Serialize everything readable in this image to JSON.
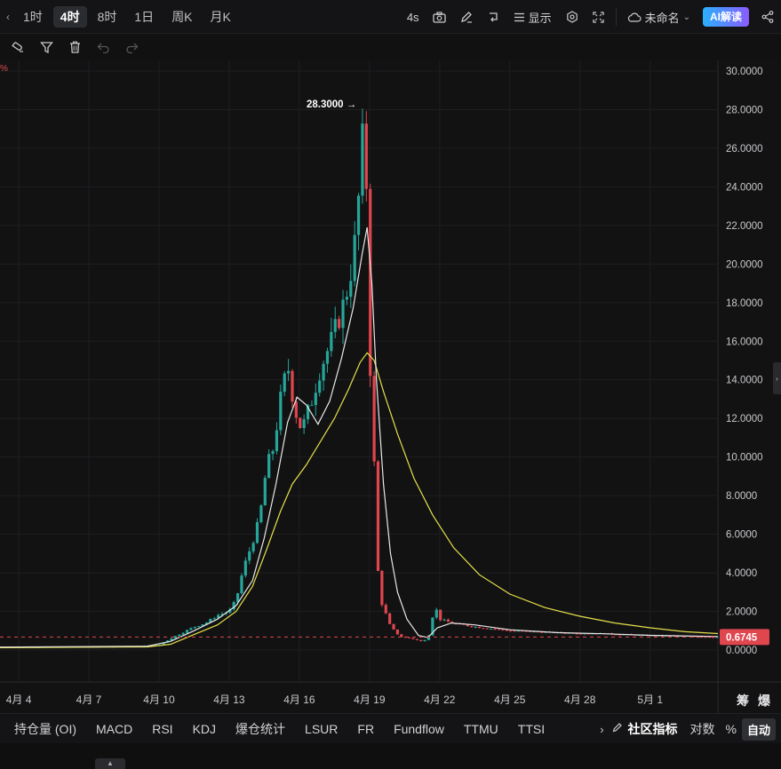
{
  "toolbar": {
    "timeframes": [
      "1时",
      "4时",
      "8时",
      "1日",
      "周K",
      "月K"
    ],
    "active_timeframe": "4时",
    "interval_label": "4s",
    "display_label": "显示",
    "layout_name": "未命名",
    "ai_label": "AI解读"
  },
  "draw_tools": [
    "magnet-icon",
    "filter-icon",
    "trash-icon",
    "undo-icon",
    "redo-icon"
  ],
  "corner_marker": "%",
  "chart_data": {
    "type": "candlestick",
    "title": "",
    "y_ticks": [
      "30.0000",
      "28.0000",
      "26.0000",
      "24.0000",
      "22.0000",
      "20.0000",
      "18.0000",
      "16.0000",
      "14.0000",
      "12.0000",
      "10.0000",
      "8.0000",
      "6.0000",
      "4.0000",
      "2.0000",
      "0.0000"
    ],
    "ylim": [
      0,
      30
    ],
    "x_ticks": [
      "4月 4",
      "4月 7",
      "4月 10",
      "4月 13",
      "4月 16",
      "4月 19",
      "4月 22",
      "4月 25",
      "4月 28",
      "5月 1"
    ],
    "x_tick_days": [
      4,
      7,
      10,
      13,
      16,
      19,
      22,
      25,
      28,
      31
    ],
    "x_range_days": [
      3.2,
      33.9
    ],
    "last_price": "0.6745",
    "last_price_value": 0.6745,
    "high_label": "28.3000",
    "high_value": 28.3,
    "high_day": 18.75,
    "up_color": "#26a69a",
    "down_color": "#e0464e",
    "ma_fast_color": "#e8e8e8",
    "ma_slow_color": "#e6e04a",
    "grid": true,
    "price_path": [
      [
        3.2,
        0.15
      ],
      [
        6,
        0.16
      ],
      [
        8,
        0.18
      ],
      [
        9,
        0.2
      ],
      [
        10,
        0.25
      ],
      [
        10.5,
        0.6
      ],
      [
        11,
        0.9
      ],
      [
        11.5,
        1.2
      ],
      [
        12,
        1.4
      ],
      [
        12.5,
        1.8
      ],
      [
        13,
        2.0
      ],
      [
        13.3,
        2.6
      ],
      [
        13.6,
        4.2
      ],
      [
        14,
        5.6
      ],
      [
        14.3,
        6.8
      ],
      [
        14.6,
        9.5
      ],
      [
        14.9,
        10.5
      ],
      [
        15.2,
        13.0
      ],
      [
        15.5,
        14.8
      ],
      [
        15.8,
        12.5
      ],
      [
        16.1,
        11.4
      ],
      [
        16.5,
        12.8
      ],
      [
        16.9,
        14.6
      ],
      [
        17.3,
        15.8
      ],
      [
        17.7,
        17.2
      ],
      [
        18.0,
        18.4
      ],
      [
        18.3,
        20.2
      ],
      [
        18.5,
        22.8
      ],
      [
        18.7,
        26.4
      ],
      [
        18.85,
        25.2
      ],
      [
        19.0,
        16.0
      ],
      [
        19.1,
        11.8
      ],
      [
        19.25,
        8.5
      ],
      [
        19.4,
        2.8
      ],
      [
        19.6,
        2.2
      ],
      [
        19.9,
        1.2
      ],
      [
        20.3,
        0.7
      ],
      [
        20.8,
        0.6
      ],
      [
        21.2,
        0.45
      ],
      [
        21.5,
        0.6
      ],
      [
        21.8,
        2.3
      ],
      [
        22.0,
        1.6
      ],
      [
        22.5,
        1.4
      ],
      [
        23.5,
        1.2
      ],
      [
        25,
        1.0
      ],
      [
        27,
        0.9
      ],
      [
        29,
        0.85
      ],
      [
        31,
        0.75
      ],
      [
        33.9,
        0.6745
      ]
    ],
    "ma_fast": [
      [
        3.2,
        0.15
      ],
      [
        9.5,
        0.2
      ],
      [
        10.5,
        0.45
      ],
      [
        11.5,
        1.0
      ],
      [
        12.5,
        1.6
      ],
      [
        13.3,
        2.3
      ],
      [
        14,
        3.6
      ],
      [
        14.5,
        5.8
      ],
      [
        15,
        8.6
      ],
      [
        15.5,
        11.8
      ],
      [
        15.9,
        13.1
      ],
      [
        16.3,
        12.7
      ],
      [
        16.8,
        11.7
      ],
      [
        17.3,
        12.9
      ],
      [
        17.8,
        15.1
      ],
      [
        18.3,
        17.7
      ],
      [
        18.7,
        20.6
      ],
      [
        18.9,
        21.9
      ],
      [
        19.1,
        19.0
      ],
      [
        19.3,
        14.0
      ],
      [
        19.6,
        8.6
      ],
      [
        19.9,
        5.0
      ],
      [
        20.2,
        3.0
      ],
      [
        20.6,
        1.6
      ],
      [
        21.1,
        0.75
      ],
      [
        21.5,
        0.65
      ],
      [
        21.9,
        1.15
      ],
      [
        22.5,
        1.4
      ],
      [
        23.5,
        1.3
      ],
      [
        25,
        1.05
      ],
      [
        27,
        0.9
      ],
      [
        29,
        0.84
      ],
      [
        31,
        0.76
      ],
      [
        33.9,
        0.7
      ]
    ],
    "ma_slow": [
      [
        3.2,
        0.12
      ],
      [
        9.5,
        0.16
      ],
      [
        10.5,
        0.3
      ],
      [
        11.5,
        0.8
      ],
      [
        12.5,
        1.3
      ],
      [
        13.3,
        2.0
      ],
      [
        14,
        3.3
      ],
      [
        14.6,
        5.2
      ],
      [
        15.2,
        7.2
      ],
      [
        15.7,
        8.6
      ],
      [
        16.3,
        9.6
      ],
      [
        16.9,
        10.8
      ],
      [
        17.5,
        12.0
      ],
      [
        18.1,
        13.5
      ],
      [
        18.6,
        14.9
      ],
      [
        18.9,
        15.4
      ],
      [
        19.2,
        15.0
      ],
      [
        19.6,
        13.4
      ],
      [
        20.2,
        11.2
      ],
      [
        20.9,
        8.9
      ],
      [
        21.7,
        7.0
      ],
      [
        22.6,
        5.3
      ],
      [
        23.7,
        3.9
      ],
      [
        25,
        2.9
      ],
      [
        26.5,
        2.2
      ],
      [
        28,
        1.75
      ],
      [
        29.5,
        1.4
      ],
      [
        31,
        1.15
      ],
      [
        32.5,
        0.95
      ],
      [
        33.9,
        0.85
      ]
    ]
  },
  "indicators": [
    "持仓量 (OI)",
    "MACD",
    "RSI",
    "KDJ",
    "爆仓统计",
    "LSUR",
    "FR",
    "Fundflow",
    "TTMU",
    "TTSI"
  ],
  "indicator_right": {
    "community_label": "社区指标",
    "log_label": "对数",
    "percent_label": "%",
    "auto_label": "自动"
  },
  "side_buttons": [
    "筹",
    "爆"
  ]
}
